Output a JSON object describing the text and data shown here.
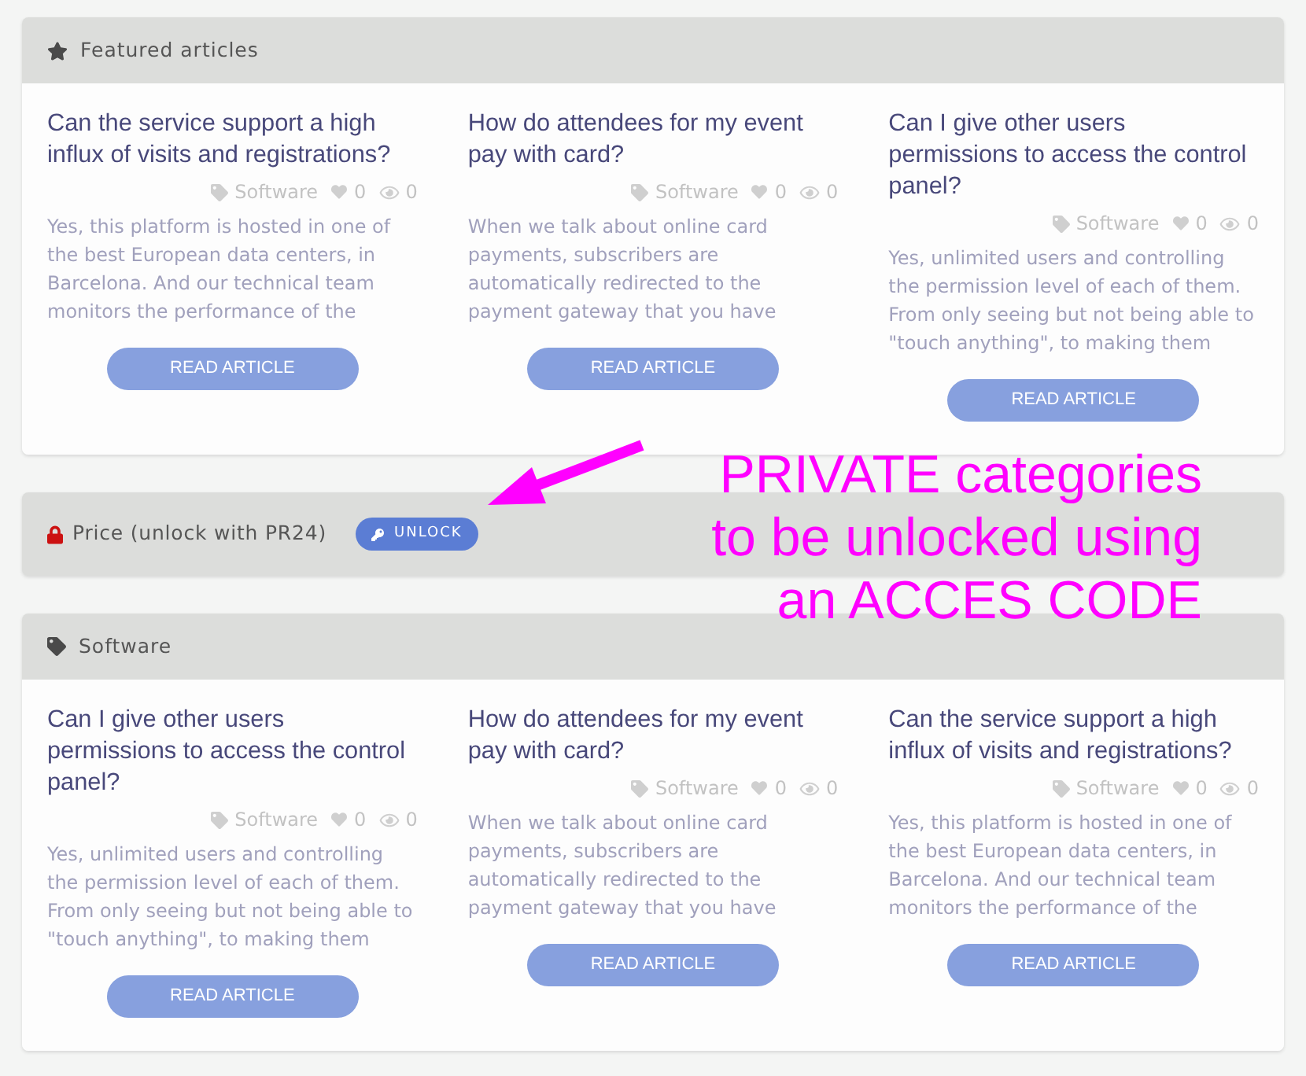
{
  "sections": [
    {
      "kind": "featured",
      "title": "Featured articles",
      "articles": [
        {
          "title": "Can the service support a high influx of visits and registrations?",
          "category": "Software",
          "likes": "0",
          "views": "0",
          "excerpt": "Yes, this platform is hosted in one of the best European data centers, in Barcelona. And our technical team monitors the performance of the",
          "button": "READ ARTICLE"
        },
        {
          "title": "How do attendees for my event pay with card?",
          "category": "Software",
          "likes": "0",
          "views": "0",
          "excerpt": "When we talk about online card payments, subscribers are automatically redirected to the payment gateway that you have",
          "button": "READ ARTICLE"
        },
        {
          "title": "Can I give other users permissions to access the control panel?",
          "category": "Software",
          "likes": "0",
          "views": "0",
          "excerpt": "Yes, unlimited users and controlling the permission level of each of them. From only seeing but not being able to \"touch anything\", to making them",
          "button": "READ ARTICLE"
        }
      ]
    },
    {
      "kind": "locked",
      "title": "Price (unlock with PR24)",
      "button": "UNLOCK"
    },
    {
      "kind": "category",
      "title": "Software",
      "articles": [
        {
          "title": "Can I give other users permissions to access the control panel?",
          "category": "Software",
          "likes": "0",
          "views": "0",
          "excerpt": "Yes, unlimited users and controlling the permission level of each of them. From only seeing but not being able to \"touch anything\", to making them",
          "button": "READ ARTICLE"
        },
        {
          "title": "How do attendees for my event pay with card?",
          "category": "Software",
          "likes": "0",
          "views": "0",
          "excerpt": "When we talk about online card payments, subscribers are automatically redirected to the payment gateway that you have",
          "button": "READ ARTICLE"
        },
        {
          "title": "Can the service support a high influx of visits and registrations?",
          "category": "Software",
          "likes": "0",
          "views": "0",
          "excerpt": "Yes, this platform is hosted in one of the best European data centers, in Barcelona. And our technical team monitors the performance of the",
          "button": "READ ARTICLE"
        }
      ]
    }
  ],
  "annotation": {
    "lines": [
      "PRIVATE categories",
      "to be unlocked using",
      "an ACCES CODE"
    ]
  }
}
